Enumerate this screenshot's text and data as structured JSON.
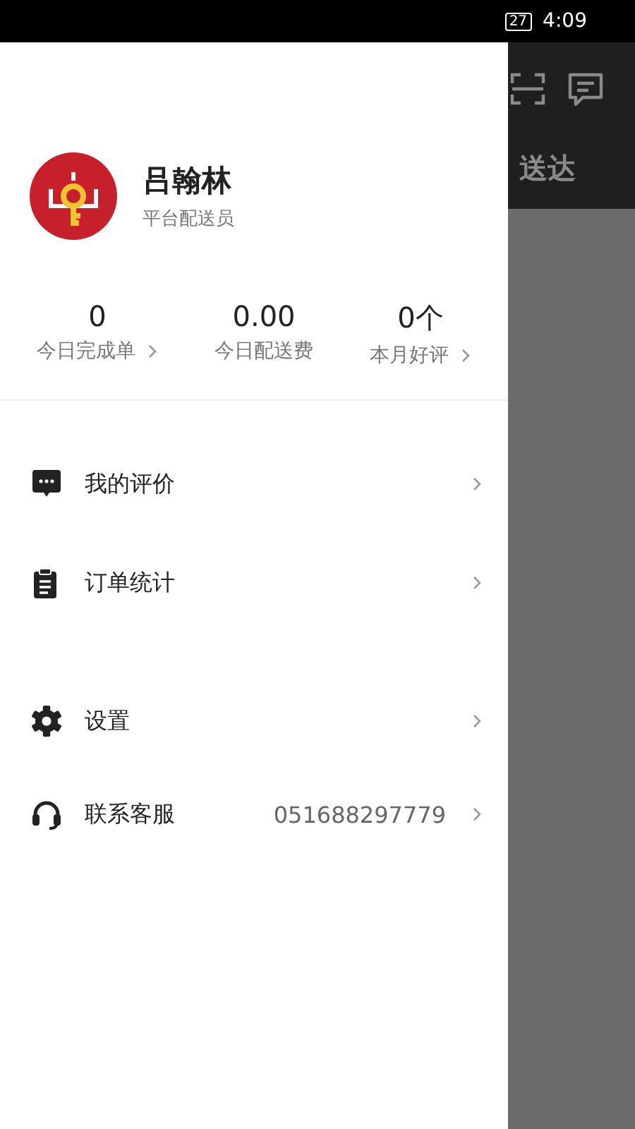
{
  "status_bar": {
    "battery": "27",
    "time": "4:09"
  },
  "background_page": {
    "header_title": "送达"
  },
  "profile": {
    "name": "吕翰林",
    "role": "平台配送员"
  },
  "stats": [
    {
      "value": "0",
      "label": "今日完成单",
      "has_arrow": true
    },
    {
      "value": "0.00",
      "label": "今日配送费",
      "has_arrow": false
    },
    {
      "value": "0个",
      "label": "本月好评",
      "has_arrow": true
    }
  ],
  "menu_groups": [
    [
      {
        "kind": "comment",
        "label": "我的评价"
      },
      {
        "kind": "clipboard",
        "label": "订单统计"
      }
    ],
    [
      {
        "kind": "gear",
        "label": "设置"
      },
      {
        "kind": "headset",
        "label": "联系客服",
        "value": "051688297779"
      }
    ]
  ]
}
